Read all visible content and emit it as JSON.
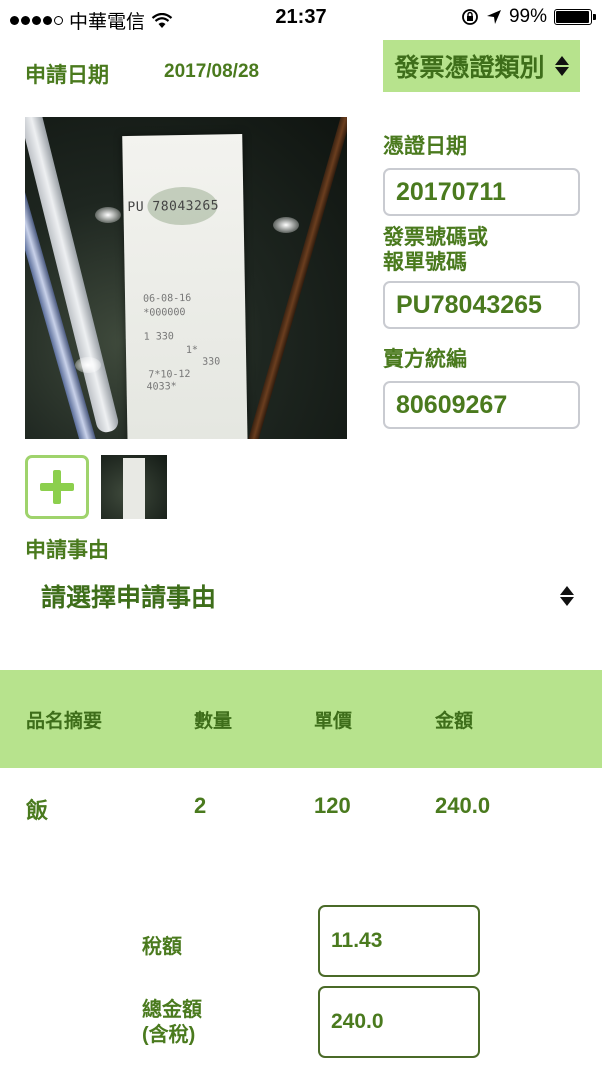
{
  "status_bar": {
    "carrier": "中華電信",
    "time": "21:37",
    "battery": "99%",
    "battery_level": 0.99
  },
  "header": {
    "apply_date_label": "申請日期",
    "apply_date_value": "2017/08/28",
    "category_select_label": "發票憑證類別"
  },
  "receipt_image": {
    "number": "78043265",
    "prefix": "PU",
    "line1": "06-08-16",
    "line2": "*000000",
    "line3": "1     330",
    "line4": "1*",
    "line5": "330",
    "line6": "7*10-12",
    "line7": "4033*"
  },
  "form": {
    "voucher_date_label": "憑證日期",
    "voucher_date_value": "20170711",
    "invoice_number_label_1": "發票號碼或",
    "invoice_number_label_2": "報單號碼",
    "invoice_number_value": "PU78043265",
    "seller_id_label": "賣方統編",
    "seller_id_value": "80609267"
  },
  "reason": {
    "label": "申請事由",
    "placeholder": "請選擇申請事由"
  },
  "table": {
    "headers": [
      "品名摘要",
      "數量",
      "單價",
      "金額"
    ],
    "rows": [
      [
        "飯",
        "2",
        "120",
        "240.0"
      ]
    ]
  },
  "totals": {
    "tax_label": "稅額",
    "tax_value": "11.43",
    "total_label_1": "總金額",
    "total_label_2": "(含稅)",
    "total_value": "240.0"
  },
  "colors": {
    "accent_green": "#b7e38d",
    "text_green": "#4a7a1e"
  }
}
